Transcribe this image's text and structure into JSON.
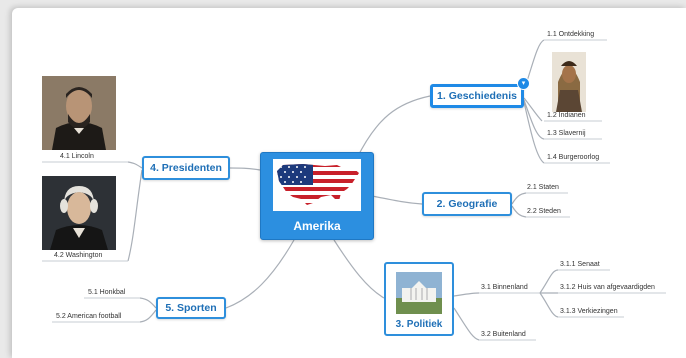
{
  "central": {
    "label": "Amerika"
  },
  "branches": {
    "geschiedenis": {
      "label": "1. Geschiedenis",
      "leaves": [
        "1.1 Ontdekking",
        "1.2 Indianen",
        "1.3 Slavernij",
        "1.4 Burgeroorlog"
      ]
    },
    "geografie": {
      "label": "2. Geografie",
      "leaves": [
        "2.1 Staten",
        "2.2 Steden"
      ]
    },
    "politiek": {
      "label": "3. Politiek",
      "binnenland": "3.1 Binnenland",
      "sub": [
        "3.1.1 Senaat",
        "3.1.2 Huis van afgevaardigden",
        "3.1.3 Verkiezingen"
      ],
      "buitenland": "3.2 Buitenland"
    },
    "presidenten": {
      "label": "4. Presidenten",
      "leaves": [
        "4.1 Lincoln",
        "4.2 Washington"
      ]
    },
    "sporten": {
      "label": "5. Sporten",
      "leaves": [
        "5.1 Honkbal",
        "5.2 American football"
      ]
    }
  },
  "colors": {
    "accent": "#2e8fdc",
    "central_fill": "#2c8fe0",
    "link": "#a9afb7"
  }
}
